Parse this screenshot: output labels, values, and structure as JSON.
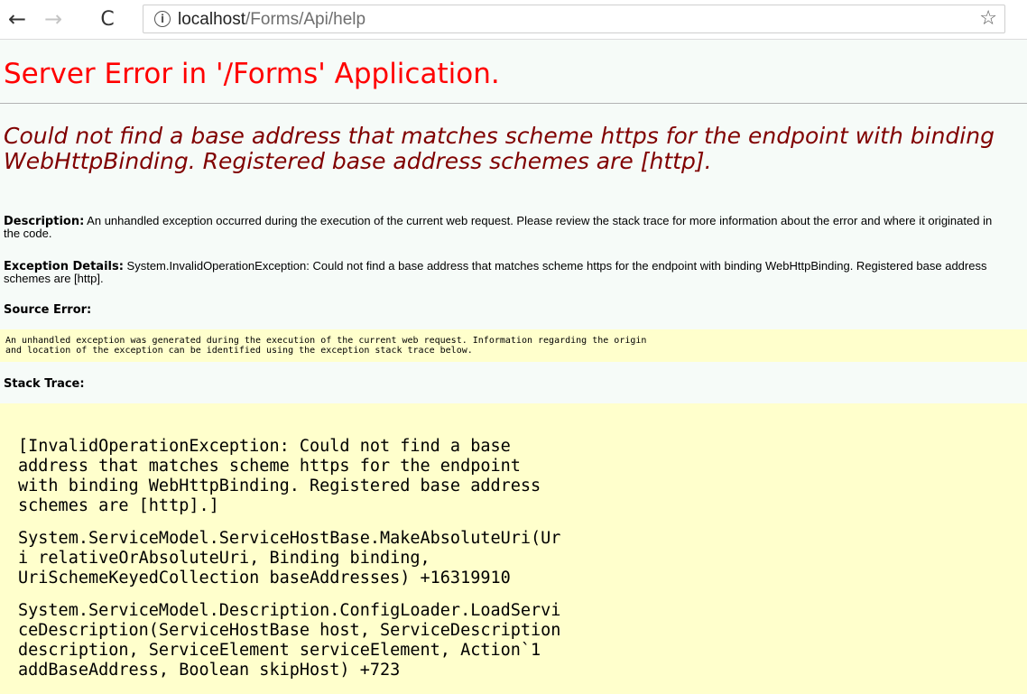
{
  "browser": {
    "back_icon": "←",
    "forward_icon": "→",
    "reload_icon": "C",
    "info_icon": "i",
    "url_host": "localhost",
    "url_path": "/Forms/Api/help",
    "star_icon": "☆"
  },
  "page": {
    "title": "Server Error in '/Forms' Application.",
    "error_message": "Could not find a base address that matches scheme https for the endpoint with binding WebHttpBinding. Registered base address schemes are [http].",
    "description": {
      "label": "Description:",
      "text": " An unhandled exception occurred during the execution of the current web request. Please review the stack trace for more information about the error and where it originated in the code."
    },
    "exception_details": {
      "label": "Exception Details:",
      "text": " System.InvalidOperationException: Could not find a base address that matches scheme https for the endpoint with binding WebHttpBinding. Registered base address schemes are [http]."
    },
    "source_error_label": "Source Error:",
    "source_error_text": "An unhandled exception was generated during the execution of the current web request. Information regarding the origin\nand location of the exception can be identified using the exception stack trace below.",
    "stack_trace_label": "Stack Trace:",
    "stack_trace": [
      "[InvalidOperationException: Could not find a base\naddress that matches scheme https for the endpoint\nwith binding WebHttpBinding. Registered base address\nschemes are [http].]",
      "System.ServiceModel.ServiceHostBase.MakeAbsoluteUri(Ur\ni relativeOrAbsoluteUri, Binding binding,\nUriSchemeKeyedCollection baseAddresses) +16319910",
      "System.ServiceModel.Description.ConfigLoader.LoadServi\nceDescription(ServiceHostBase host, ServiceDescription\ndescription, ServiceElement serviceElement, Action`1\naddBaseAddress, Boolean skipHost) +723"
    ]
  }
}
